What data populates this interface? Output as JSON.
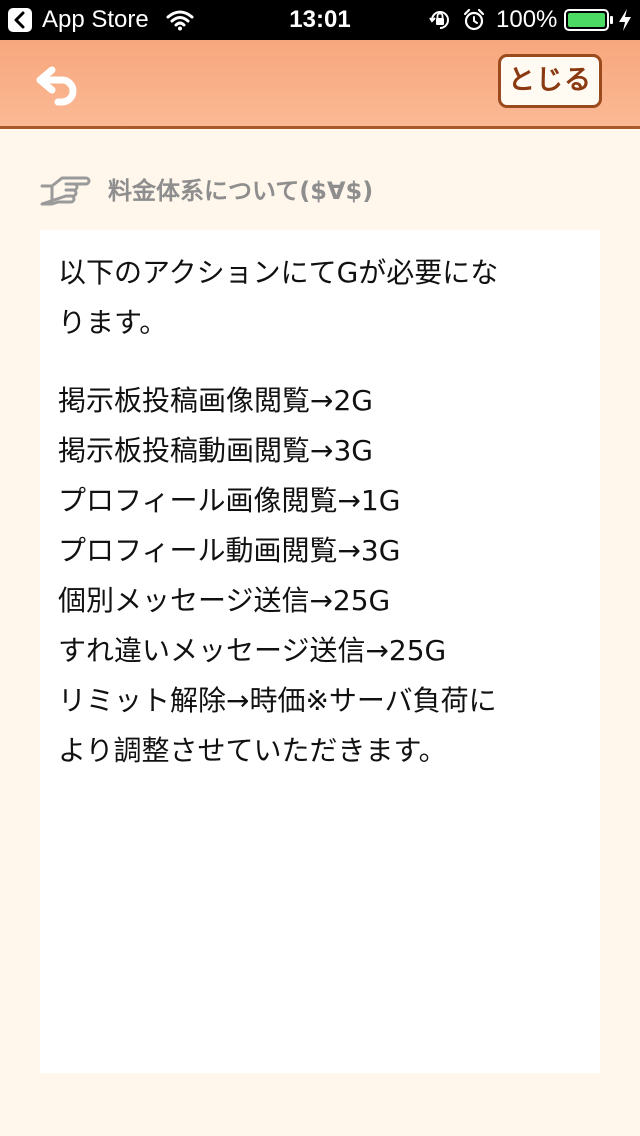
{
  "status_bar": {
    "app_name": "App Store",
    "time": "13:01",
    "battery": "100%"
  },
  "nav": {
    "close_label": "とじる",
    "colors": {
      "bar_top": "#f7a77d",
      "bar_bottom": "#fbb994",
      "border": "#a85a2a",
      "close_text": "#8a3a10"
    }
  },
  "section": {
    "title": "料金体系について($∀$)"
  },
  "content": {
    "intro_lines": [
      "以下のアクションにてGが必要にな",
      "ります。"
    ],
    "items": [
      "掲示板投稿画像閲覧→2G",
      "掲示板投稿動画閲覧→3G",
      "プロフィール画像閲覧→1G",
      "プロフィール動画閲覧→3G",
      "個別メッセージ送信→25G",
      "すれ違いメッセージ送信→25G",
      "リミット解除→時価※サーバ負荷に",
      "より調整させていただきます。"
    ]
  },
  "icons": {
    "undo": "undo-arrow-icon",
    "hand": "pointing-hand-icon",
    "wifi": "wifi-icon",
    "lock": "rotation-lock-icon",
    "alarm": "alarm-icon",
    "battery": "battery-icon",
    "charge": "charging-bolt-icon"
  }
}
